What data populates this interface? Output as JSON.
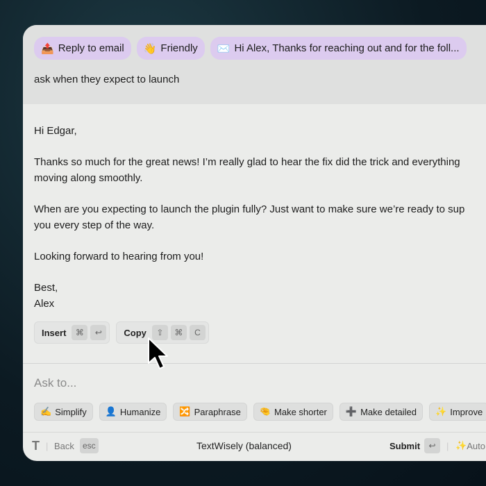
{
  "chips": [
    {
      "icon": "inbox-tray-icon",
      "emoji": "📤",
      "label": "Reply to email"
    },
    {
      "icon": "waving-hand-icon",
      "emoji": "👋",
      "label": "Friendly"
    },
    {
      "icon": "mail-app-icon",
      "emoji": "✉️",
      "label": "Hi Alex, Thanks for reaching out and for the foll..."
    }
  ],
  "prompt": "ask when they expect to launch",
  "email": {
    "greeting": "Hi Edgar,",
    "p1a": "Thanks so much for the great news! I’m really glad to hear the fix did the trick and everything",
    "p1b": "moving along smoothly.",
    "p2a": "When are you expecting to launch the plugin fully? Just want to make sure we’re ready to sup",
    "p2b": "you every step of the way.",
    "p3": "Looking forward to hearing from you!",
    "signoff": "Best,",
    "name": "Alex"
  },
  "actions": {
    "insert": "Insert",
    "insert_keys": [
      "⌘",
      "↩"
    ],
    "copy": "Copy",
    "copy_keys": [
      "⇧",
      "⌘",
      "C"
    ]
  },
  "ask_placeholder": "Ask to...",
  "tools": [
    {
      "emoji": "✍️",
      "label": "Simplify"
    },
    {
      "emoji": "👤",
      "label": "Humanize"
    },
    {
      "emoji": "🔀",
      "label": "Paraphrase"
    },
    {
      "emoji": "🤏",
      "label": "Make shorter"
    },
    {
      "emoji": "➕",
      "label": "Make detailed"
    },
    {
      "emoji": "✨",
      "label": "Improve"
    }
  ],
  "footer": {
    "back": "Back",
    "esc": "esc",
    "model": "TextWisely (balanced)",
    "submit": "Submit",
    "enter": "↩",
    "auto": "Auto"
  }
}
